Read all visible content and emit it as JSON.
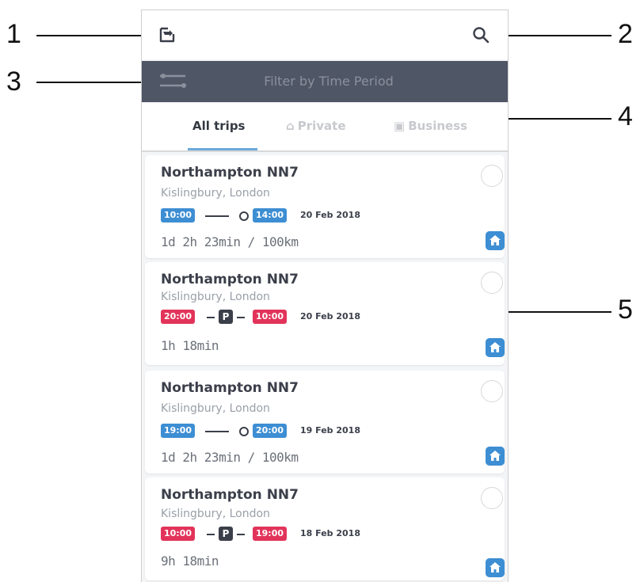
{
  "callouts": [
    "1",
    "2",
    "3",
    "4",
    "5"
  ],
  "topbar": {
    "export_icon": "export-icon",
    "search_icon": "search-icon"
  },
  "filter": {
    "label": "Filter by Time Period",
    "icon": "filter-sliders-icon"
  },
  "tabs": [
    {
      "label": "All trips",
      "active": true
    },
    {
      "label": "Private",
      "icon": "home-icon",
      "active": false
    },
    {
      "label": "Business",
      "icon": "briefcase-icon",
      "active": false
    }
  ],
  "colors": {
    "accent_blue": "#3d8ed3",
    "accent_red": "#e2345a",
    "filter_bg": "#4f5666",
    "text_dark": "#3b3f4a"
  },
  "trips": [
    {
      "title": "Northampton NN7",
      "subtitle": "Kislingbury, London",
      "start": "10:00",
      "end": "14:00",
      "date": "20 Feb 2018",
      "duration": "1d 2h 23min / 100km",
      "kind": "drive",
      "color": "blue"
    },
    {
      "title": "Northampton NN7",
      "subtitle": "Kislingbury, London",
      "start": "20:00",
      "end": "10:00",
      "date": "20 Feb 2018",
      "duration": "1h 18min",
      "kind": "parking",
      "parking_label": "P",
      "color": "red"
    },
    {
      "title": "Northampton NN7",
      "subtitle": "Kislingbury, London",
      "start": "19:00",
      "end": "20:00",
      "date": "19 Feb 2018",
      "duration": "1d 2h 23min / 100km",
      "kind": "drive",
      "color": "blue"
    },
    {
      "title": "Northampton NN7",
      "subtitle": "Kislingbury, London",
      "start": "10:00",
      "end": "19:00",
      "date": "18 Feb 2018",
      "duration": "9h 18min",
      "kind": "parking",
      "parking_label": "P",
      "color": "red"
    }
  ]
}
